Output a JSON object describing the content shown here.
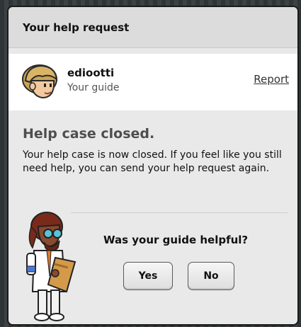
{
  "dialog": {
    "title": "Your help request"
  },
  "guide": {
    "name": "ediootti",
    "role": "Your guide",
    "report_label": "Report"
  },
  "status": {
    "title": "Help case closed.",
    "message": "Your help case is now closed. If you feel like you still need help, you can send your help request again."
  },
  "feedback": {
    "question": "Was your guide helpful?",
    "yes_label": "Yes",
    "no_label": "No"
  }
}
